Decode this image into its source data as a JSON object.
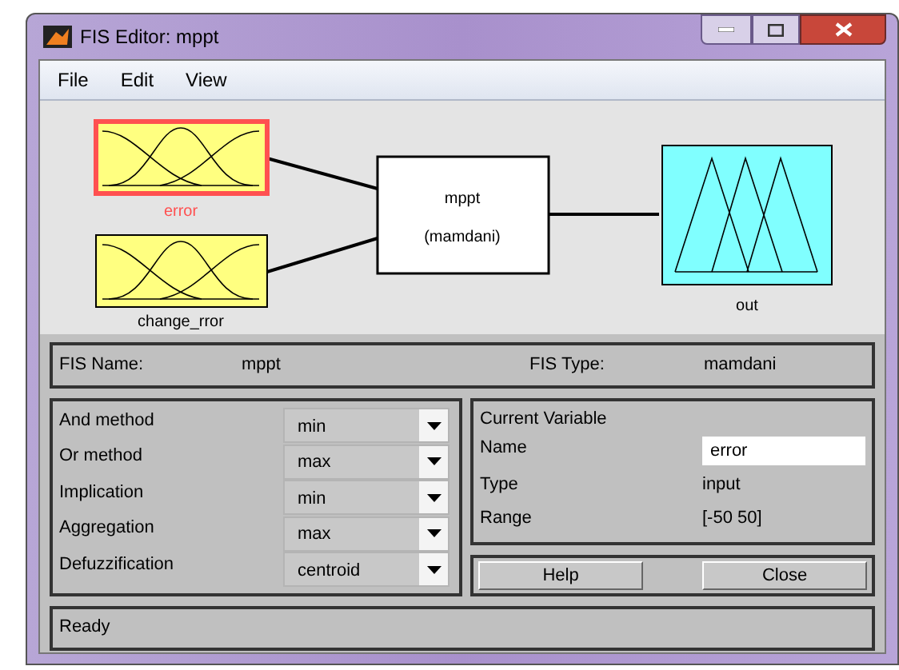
{
  "window": {
    "title": "FIS Editor: mppt"
  },
  "menu": [
    "File",
    "Edit",
    "View"
  ],
  "diagram": {
    "inputs": [
      {
        "name": "error",
        "selected": true
      },
      {
        "name": "change_rror",
        "selected": false
      }
    ],
    "system": {
      "name": "mppt",
      "type": "(mamdani)"
    },
    "outputs": [
      {
        "name": "out",
        "selected": false
      }
    ]
  },
  "fis": {
    "name_label": "FIS Name:",
    "name": "mppt",
    "type_label": "FIS Type:",
    "type": "mamdani"
  },
  "methods": [
    {
      "label": "And method",
      "value": "min"
    },
    {
      "label": "Or method",
      "value": "max"
    },
    {
      "label": "Implication",
      "value": "min"
    },
    {
      "label": "Aggregation",
      "value": "max"
    },
    {
      "label": "Defuzzification",
      "value": "centroid"
    }
  ],
  "current_variable": {
    "title": "Current Variable",
    "name_label": "Name",
    "name": "error",
    "type_label": "Type",
    "type": "input",
    "range_label": "Range",
    "range": "[-50 50]"
  },
  "buttons": [
    "Help",
    "Close"
  ],
  "status_bar": "Ready"
}
